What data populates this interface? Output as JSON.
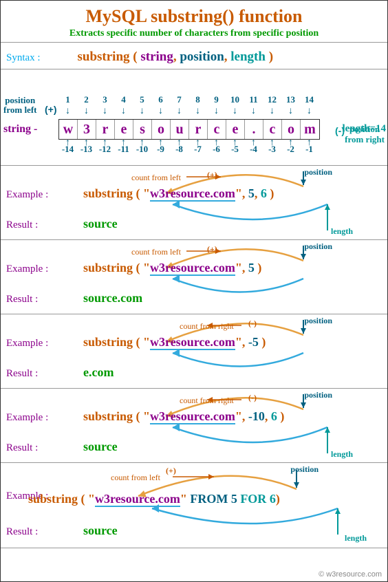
{
  "title": "MySQL substring() function",
  "subtitle": "Extracts specific number of characters from specific position",
  "syntax": {
    "label": "Syntax :",
    "fn": "substring",
    "open": " ( ",
    "close": " )",
    "arg_string": "string",
    "arg_position": "position",
    "arg_length": "length",
    "comma": ", "
  },
  "diagram": {
    "pos_from_left": "position\nfrom left",
    "pos_from_right": "position\nfrom right",
    "plus": "(+)",
    "minus": "(-)",
    "string_label": "string -",
    "length_label": "length=14",
    "chars": [
      "w",
      "3",
      "r",
      "e",
      "s",
      "o",
      "u",
      "r",
      "c",
      "e",
      ".",
      "c",
      "o",
      "m"
    ],
    "top_nums": [
      "1",
      "2",
      "3",
      "4",
      "5",
      "6",
      "7",
      "8",
      "9",
      "10",
      "11",
      "12",
      "13",
      "14"
    ],
    "bot_nums": [
      "-14",
      "-13",
      "-12",
      "-11",
      "-10",
      "-9",
      "-8",
      "-7",
      "-6",
      "-5",
      "-4",
      "-3",
      "-2",
      "-1"
    ]
  },
  "labels": {
    "example": "Example :",
    "result": "Result :",
    "count_left": "count from left",
    "count_right": "count from right",
    "position": "position",
    "length": "length",
    "plus": "(+)",
    "minus": "(-)"
  },
  "examples": [
    {
      "call_parts": {
        "fn": "substring",
        "open": " ( ",
        "q1": "\"",
        "str": "w3resource.com",
        "q2": "\"",
        "c1": ", ",
        "p": "5",
        "c2": ", ",
        "l": "6",
        "close": " )"
      },
      "result": "source",
      "count_dir": "left",
      "sign": "+",
      "has_length": true
    },
    {
      "call_parts": {
        "fn": "substring",
        "open": " ( ",
        "q1": "\"",
        "str": "w3resource.com",
        "q2": "\"",
        "c1": ", ",
        "p": "5",
        "c2": "  ",
        "l": "",
        "close": " )"
      },
      "result": "source.com",
      "count_dir": "left",
      "sign": "+",
      "has_length": false
    },
    {
      "call_parts": {
        "fn": "substring",
        "open": " ( ",
        "q1": "\"",
        "str": "w3resource.com",
        "q2": "\"",
        "c1": ",  ",
        "p": "-5",
        "c2": "",
        "l": "",
        "close": " )"
      },
      "result": "e.com",
      "count_dir": "right",
      "sign": "-",
      "has_length": false
    },
    {
      "call_parts": {
        "fn": "substring",
        "open": " ( ",
        "q1": "\"",
        "str": "w3resource.com",
        "q2": "\"",
        "c1": ",  ",
        "p": "-10",
        "c2": ", ",
        "l": "6",
        "close": " )"
      },
      "result": "source",
      "count_dir": "right",
      "sign": "-",
      "has_length": true
    }
  ],
  "example5": {
    "call_parts": {
      "fn": "substring",
      "open": " ( ",
      "q1": "\"",
      "str": "w3resource.com",
      "q2": "\"",
      "sp": "  ",
      "kw1": "FROM",
      "sp2": "  ",
      "p": "5",
      "sp3": "  ",
      "kw2": "FOR",
      "sp4": "  ",
      "l": "6",
      "close": ")"
    },
    "result": "source",
    "count_dir": "left",
    "sign": "+",
    "has_length": true
  },
  "footer": "© w3resource.com"
}
